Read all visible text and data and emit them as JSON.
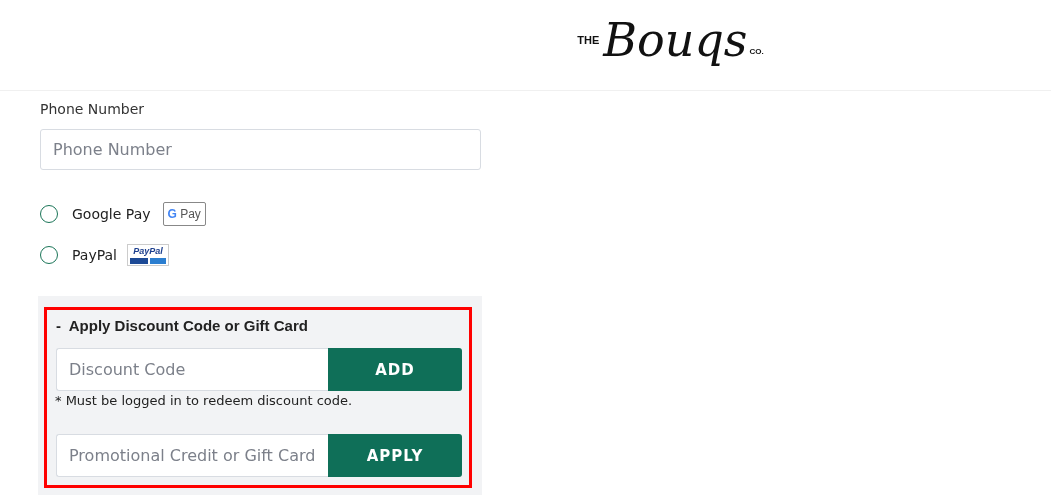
{
  "logo": {
    "prefix": "THE",
    "name": "Bouqs",
    "suffix": "CO."
  },
  "phone": {
    "label": "Phone Number",
    "placeholder": "Phone Number"
  },
  "payment_options": [
    {
      "kind": "gpay",
      "label": "Google Pay",
      "selected": false,
      "badge": [
        "G",
        "Pay"
      ]
    },
    {
      "kind": "paypal",
      "label": "PayPal",
      "selected": false,
      "badge": [
        "PayPal"
      ]
    }
  ],
  "discount": {
    "expanded": true,
    "toggle": "-",
    "title": "Apply Discount Code or Gift Card",
    "highlighted": true,
    "rows": [
      {
        "placeholder": "Discount Code",
        "button": "ADD",
        "note": "* Must be logged in to redeem discount code."
      },
      {
        "placeholder": "Promotional Credit or Gift Card",
        "button": "APPLY"
      }
    ]
  }
}
